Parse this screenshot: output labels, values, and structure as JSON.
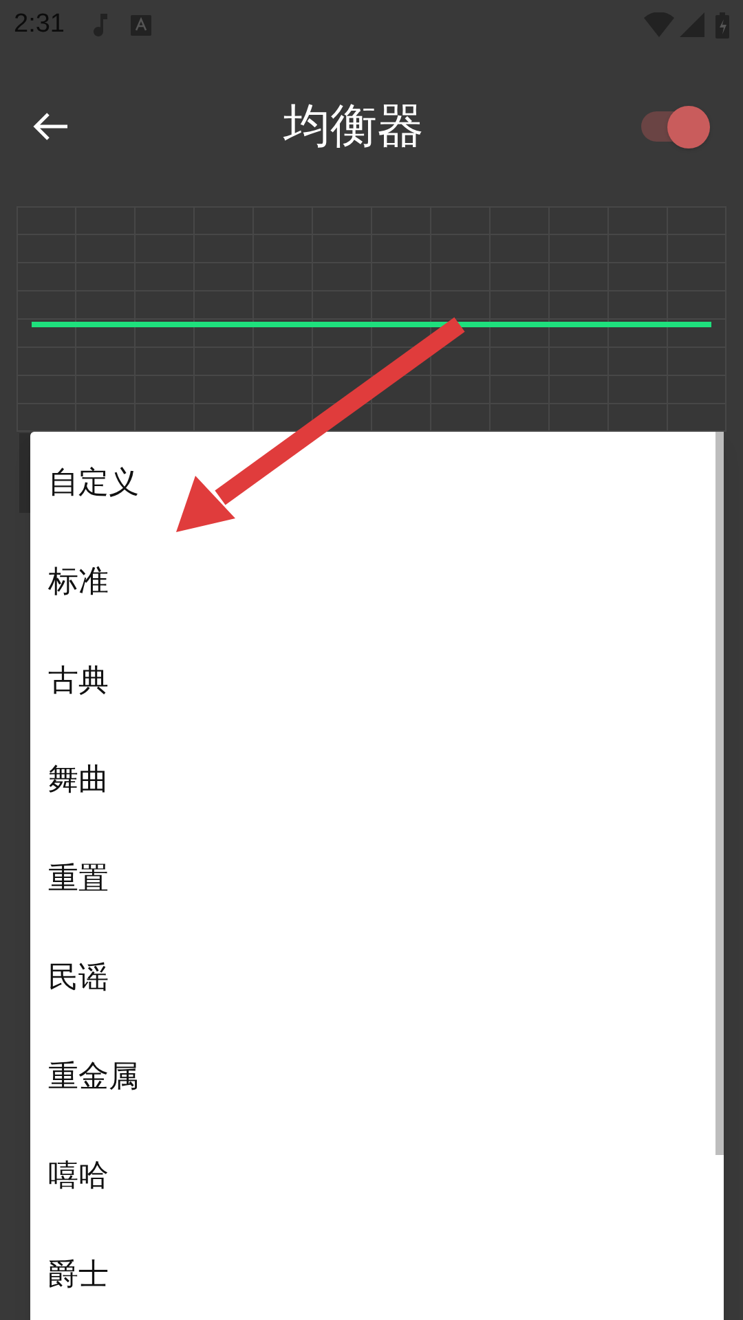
{
  "status_bar": {
    "time": "2:31"
  },
  "app_bar": {
    "title": "均衡器",
    "equalizer_switch": {
      "on": true
    }
  },
  "preset_menu": {
    "items": [
      {
        "label": "自定义"
      },
      {
        "label": "标准"
      },
      {
        "label": "古典"
      },
      {
        "label": "舞曲"
      },
      {
        "label": "重置"
      },
      {
        "label": "民谣"
      },
      {
        "label": "重金属"
      },
      {
        "label": "嘻哈"
      },
      {
        "label": "爵士"
      }
    ]
  }
}
